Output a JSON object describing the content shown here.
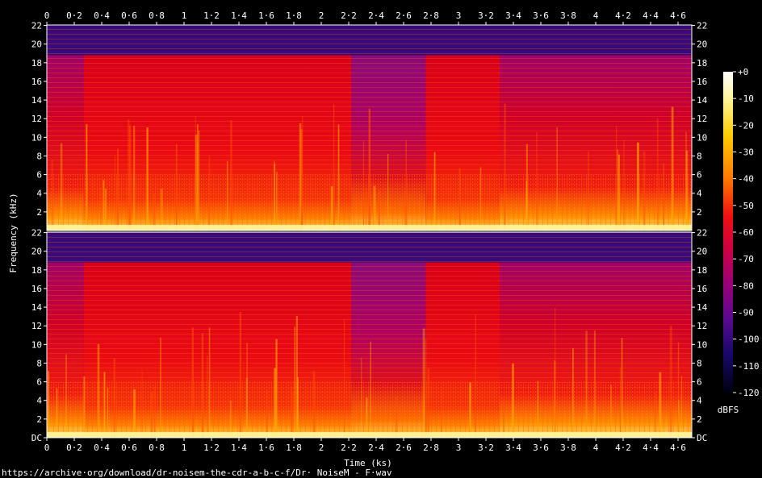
{
  "chart_data": {
    "type": "heatmap",
    "title": "",
    "xlabel": "Time (ks)",
    "ylabel": "Frequency (kHz)",
    "x_ticks": [
      "0",
      "0·2",
      "0·4",
      "0·6",
      "0·8",
      "1",
      "1·2",
      "1·4",
      "1·6",
      "1·8",
      "2",
      "2·2",
      "2·4",
      "2·6",
      "2·8",
      "3",
      "3·2",
      "3·4",
      "3·6",
      "3·8",
      "4",
      "4·2",
      "4·4",
      "4·6"
    ],
    "x_range": [
      0,
      4.7
    ],
    "y_ticks_top": [
      "22",
      "20",
      "18",
      "16",
      "14",
      "12",
      "10",
      "8",
      "6",
      "4",
      "2"
    ],
    "y_ticks_bottom": [
      "22",
      "20",
      "18",
      "16",
      "14",
      "12",
      "10",
      "8",
      "6",
      "4",
      "2",
      "DC"
    ],
    "y_range_khz": [
      0,
      22.05
    ],
    "channels": 2,
    "colorbar": {
      "label": "dBFS",
      "ticks": [
        "+0",
        "-10",
        "-20",
        "-30",
        "-40",
        "-50",
        "-60",
        "-70",
        "-80",
        "-90",
        "-100",
        "-110",
        "-120"
      ],
      "range": [
        -120,
        0
      ]
    },
    "segments_ks": [
      {
        "start": 0.0,
        "end": 0.27,
        "cutoff_khz": 18.8
      },
      {
        "start": 0.27,
        "end": 2.22,
        "cutoff_khz": 18.8
      },
      {
        "start": 2.22,
        "end": 2.76,
        "cutoff_khz": 18.8
      },
      {
        "start": 2.76,
        "end": 3.3,
        "cutoff_khz": 18.8
      },
      {
        "start": 3.3,
        "end": 4.7,
        "cutoff_khz": 18.8
      }
    ],
    "source_path": "https://archive·org/download/dr-noisem-the-cdr-a-b-c-f/Dr· NoiseM - F·wav"
  },
  "colors": {
    "background": "#000000",
    "text": "#ffffff",
    "noise_floor": "#3a0a78",
    "mid_band": "#e8001c",
    "low_band": "#ff9a00",
    "peak": "#fff6a0"
  }
}
